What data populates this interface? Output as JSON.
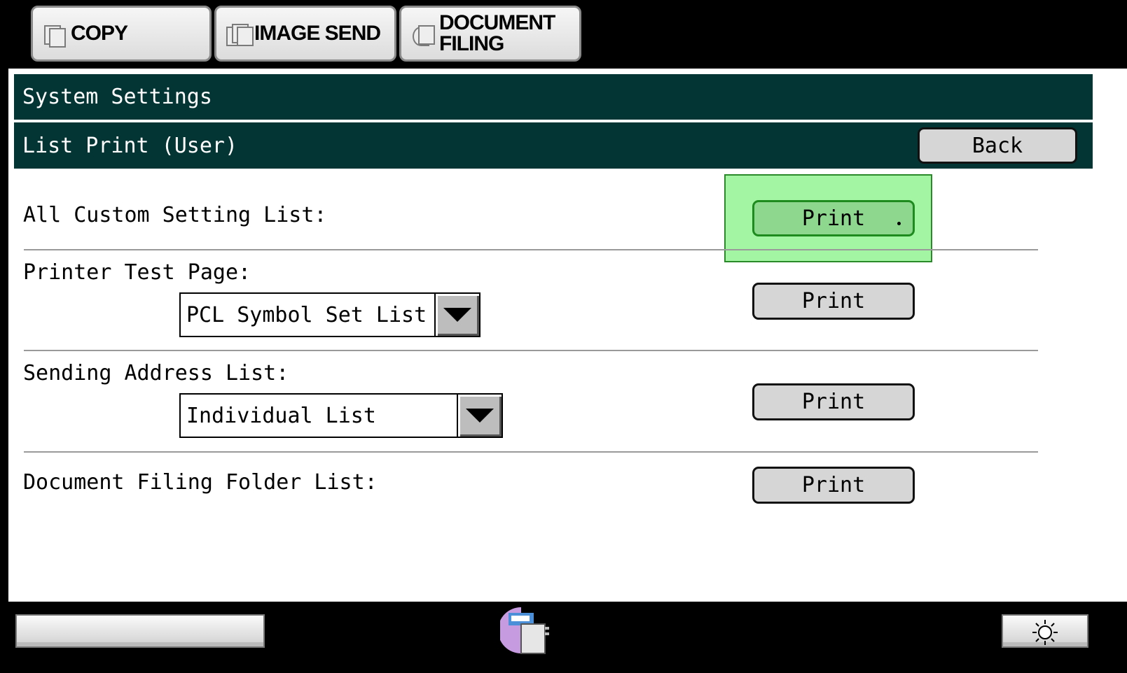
{
  "tabs": {
    "copy": "COPY",
    "image_send": "IMAGE SEND",
    "document_filing_line1": "DOCUMENT",
    "document_filing_line2": "FILING"
  },
  "header": {
    "title": "System Settings",
    "subtitle": "List Print (User)",
    "back_label": "Back"
  },
  "rows": [
    {
      "label": "All Custom Setting List:",
      "button": "Print"
    },
    {
      "label": "Printer Test Page:",
      "select_value": "PCL Symbol Set List",
      "button": "Print"
    },
    {
      "label": "Sending Address List:",
      "select_value": "Individual List",
      "button": "Print"
    },
    {
      "label": "Document Filing Folder List:",
      "button": "Print"
    }
  ],
  "icons": {
    "copy": "copy-icon",
    "image_send": "image-send-icon",
    "document_filing": "document-filing-icon",
    "job_status": "machine-status-icon",
    "brightness": "brightness-icon"
  },
  "colors": {
    "header_bg": "#043535",
    "highlight": "#a3f5a3",
    "active_button": "#8ed78e"
  }
}
